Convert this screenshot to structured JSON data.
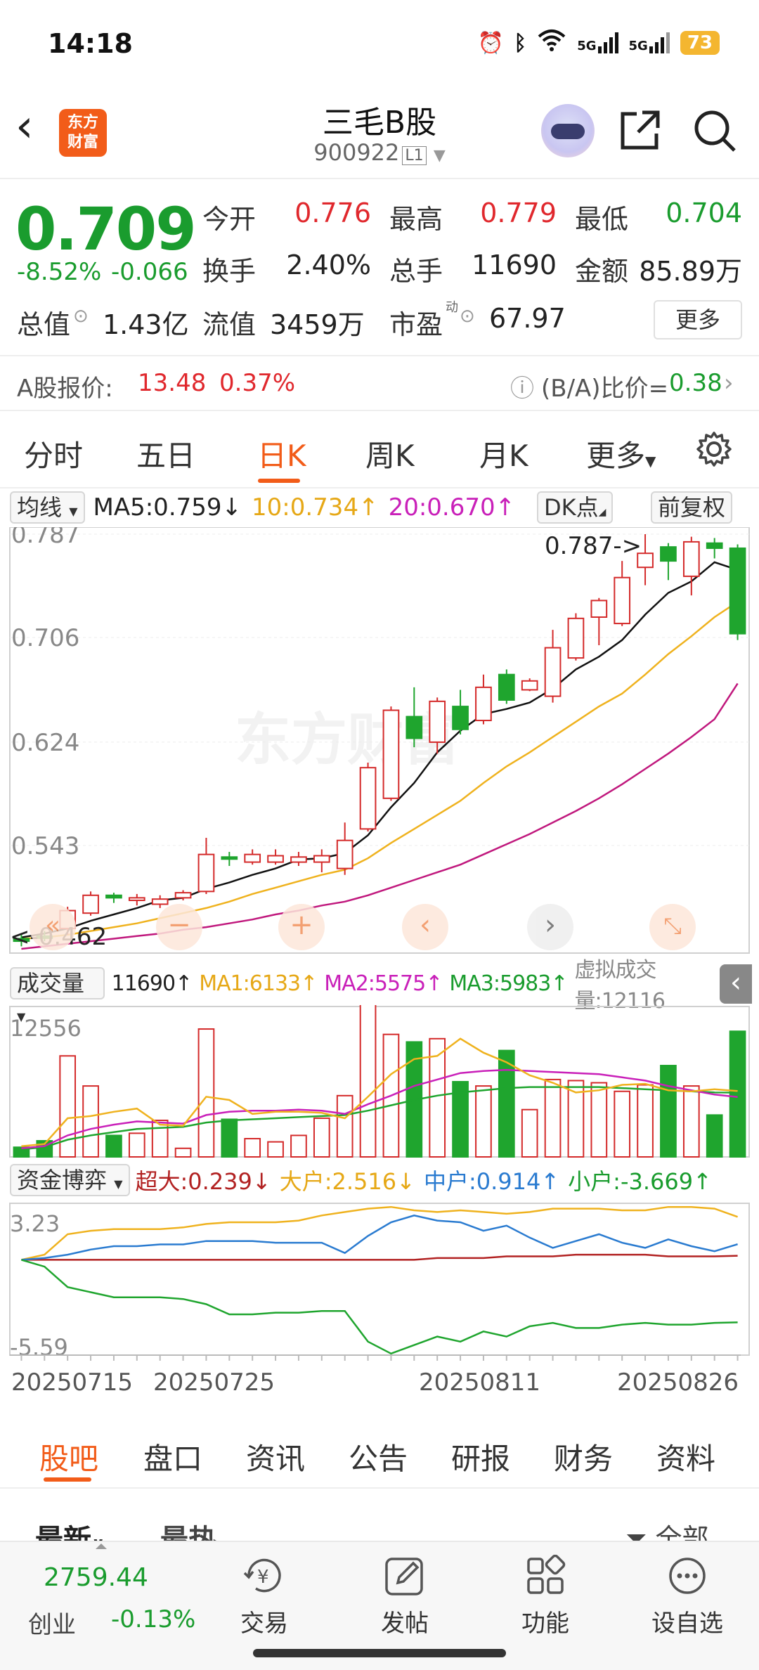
{
  "status": {
    "time": "14:18",
    "battery": "73",
    "signal1": "5G",
    "signal2": "5G"
  },
  "header": {
    "logo_line1": "东方",
    "logo_line2": "财富",
    "title": "三毛B股",
    "code": "900922",
    "code_badge": "L1"
  },
  "quote": {
    "price": "0.709",
    "change_pct": "-8.52%",
    "change_abs": "-0.066",
    "open_label": "今开",
    "open": "0.776",
    "high_label": "最高",
    "high": "0.779",
    "low_label": "最低",
    "low": "0.704",
    "turnover_label": "换手",
    "turnover": "2.40%",
    "volume_label": "总手",
    "volume": "11690",
    "amount_label": "金额",
    "amount": "85.89万",
    "mktcap_label": "总值",
    "mktcap": "1.43亿",
    "float_label": "流值",
    "float": "3459万",
    "pe_label": "市盈",
    "pe_sup": "动",
    "pe": "67.97",
    "more": "更多",
    "a_label": "A股报价:",
    "a_price": "13.48",
    "a_pct": "0.37%",
    "ba_label": "(B/A)比价=",
    "ba_value": "0.38"
  },
  "tabs": [
    "分时",
    "五日",
    "日K",
    "周K",
    "月K",
    "更多"
  ],
  "active_tab": "日K",
  "kline": {
    "indicator": "均线",
    "ma5": "MA5:0.759↓",
    "ma10": "10:0.734↑",
    "ma20": "20:0.670↑",
    "dk_label": "DK点",
    "adjust_label": "前复权",
    "y_labels": [
      "0.787",
      "0.706",
      "0.624",
      "0.543"
    ],
    "high_marker": "0.787->",
    "low_marker": "<-0.462",
    "watermark": "东方财富"
  },
  "volume": {
    "indicator": "成交量",
    "value": "11690↑",
    "ma1": "MA1:6133↑",
    "ma2": "MA2:5575↑",
    "ma3": "MA3:5983↑",
    "virtual": "虚拟成交量:12116",
    "max_label": "12556"
  },
  "fund": {
    "indicator": "资金博弈",
    "super": "超大:0.239↓",
    "large": "大户:2.516↓",
    "mid": "中户:0.914↑",
    "small": "小户:-3.669↑",
    "top_label": "3.23",
    "bottom_label": "-5.59"
  },
  "dates": [
    "20250715",
    "20250725",
    "20250811",
    "20250826"
  ],
  "bottom_tabs": [
    "股吧",
    "盘口",
    "资讯",
    "公告",
    "研报",
    "财务",
    "资料"
  ],
  "sub_tabs": {
    "latest": "最新",
    "hot": "最热",
    "all": "全部"
  },
  "dock": {
    "index_value": "2759.44",
    "index_name": "创业",
    "index_pct": "-0.13%",
    "items": [
      "交易",
      "发帖",
      "功能",
      "设自选"
    ]
  },
  "chart_data": {
    "type": "candlestick",
    "candles": [
      {
        "o": 0.47,
        "c": 0.468,
        "h": 0.474,
        "l": 0.464
      },
      {
        "o": 0.472,
        "c": 0.471,
        "h": 0.476,
        "l": 0.468
      },
      {
        "o": 0.478,
        "c": 0.492,
        "h": 0.495,
        "l": 0.473
      },
      {
        "o": 0.49,
        "c": 0.504,
        "h": 0.507,
        "l": 0.488
      },
      {
        "o": 0.504,
        "c": 0.502,
        "h": 0.506,
        "l": 0.498
      },
      {
        "o": 0.5,
        "c": 0.502,
        "h": 0.505,
        "l": 0.496
      },
      {
        "o": 0.497,
        "c": 0.501,
        "h": 0.504,
        "l": 0.494
      },
      {
        "o": 0.502,
        "c": 0.506,
        "h": 0.508,
        "l": 0.5
      },
      {
        "o": 0.507,
        "c": 0.536,
        "h": 0.549,
        "l": 0.505
      },
      {
        "o": 0.534,
        "c": 0.533,
        "h": 0.538,
        "l": 0.527
      },
      {
        "o": 0.53,
        "c": 0.536,
        "h": 0.54,
        "l": 0.528
      },
      {
        "o": 0.53,
        "c": 0.535,
        "h": 0.54,
        "l": 0.528
      },
      {
        "o": 0.53,
        "c": 0.534,
        "h": 0.538,
        "l": 0.527
      },
      {
        "o": 0.53,
        "c": 0.535,
        "h": 0.54,
        "l": 0.522
      },
      {
        "o": 0.525,
        "c": 0.547,
        "h": 0.561,
        "l": 0.52
      },
      {
        "o": 0.556,
        "c": 0.604,
        "h": 0.608,
        "l": 0.554
      },
      {
        "o": 0.58,
        "c": 0.649,
        "h": 0.652,
        "l": 0.578
      },
      {
        "o": 0.644,
        "c": 0.627,
        "h": 0.667,
        "l": 0.62
      },
      {
        "o": 0.624,
        "c": 0.656,
        "h": 0.659,
        "l": 0.615
      },
      {
        "o": 0.652,
        "c": 0.634,
        "h": 0.665,
        "l": 0.63
      },
      {
        "o": 0.641,
        "c": 0.667,
        "h": 0.677,
        "l": 0.638
      },
      {
        "o": 0.677,
        "c": 0.657,
        "h": 0.681,
        "l": 0.654
      },
      {
        "o": 0.665,
        "c": 0.672,
        "h": 0.674,
        "l": 0.664
      },
      {
        "o": 0.66,
        "c": 0.698,
        "h": 0.712,
        "l": 0.655
      },
      {
        "o": 0.69,
        "c": 0.721,
        "h": 0.725,
        "l": 0.688
      },
      {
        "o": 0.722,
        "c": 0.735,
        "h": 0.737,
        "l": 0.7
      },
      {
        "o": 0.717,
        "c": 0.753,
        "h": 0.766,
        "l": 0.715
      },
      {
        "o": 0.761,
        "c": 0.772,
        "h": 0.787,
        "l": 0.747
      },
      {
        "o": 0.777,
        "c": 0.766,
        "h": 0.78,
        "l": 0.751
      },
      {
        "o": 0.754,
        "c": 0.781,
        "h": 0.785,
        "l": 0.739
      },
      {
        "o": 0.78,
        "c": 0.776,
        "h": 0.784,
        "l": 0.768
      },
      {
        "o": 0.776,
        "c": 0.709,
        "h": 0.779,
        "l": 0.704
      }
    ],
    "ma5": [
      0.471,
      0.474,
      0.478,
      0.484,
      0.489,
      0.494,
      0.5,
      0.502,
      0.509,
      0.514,
      0.52,
      0.525,
      0.532,
      0.533,
      0.537,
      0.551,
      0.573,
      0.592,
      0.616,
      0.633,
      0.646,
      0.65,
      0.655,
      0.666,
      0.681,
      0.691,
      0.704,
      0.724,
      0.741,
      0.75,
      0.765,
      0.759
    ],
    "ma10": [
      0.47,
      0.471,
      0.473,
      0.476,
      0.479,
      0.482,
      0.486,
      0.49,
      0.494,
      0.499,
      0.505,
      0.51,
      0.515,
      0.52,
      0.524,
      0.533,
      0.545,
      0.556,
      0.567,
      0.578,
      0.592,
      0.605,
      0.616,
      0.628,
      0.64,
      0.652,
      0.662,
      0.677,
      0.693,
      0.707,
      0.722,
      0.734
    ],
    "ma20": [
      0.462,
      0.464,
      0.466,
      0.468,
      0.47,
      0.472,
      0.474,
      0.477,
      0.479,
      0.482,
      0.485,
      0.489,
      0.492,
      0.496,
      0.499,
      0.504,
      0.51,
      0.516,
      0.522,
      0.528,
      0.536,
      0.544,
      0.552,
      0.561,
      0.57,
      0.58,
      0.591,
      0.603,
      0.615,
      0.628,
      0.642,
      0.67
    ],
    "volume": [
      900,
      1500,
      9400,
      6600,
      2000,
      2200,
      3400,
      800,
      11900,
      3500,
      1700,
      1400,
      2000,
      3600,
      5700,
      14200,
      11400,
      10700,
      11000,
      7000,
      6600,
      9900,
      4400,
      7200,
      7100,
      6900,
      6100,
      6700,
      8500,
      6600,
      3900,
      11690
    ],
    "vol_ma1": [
      1000,
      1200,
      3600,
      3800,
      4200,
      4500,
      3000,
      2900,
      5600,
      5300,
      4000,
      4200,
      4200,
      4100,
      3600,
      5600,
      7700,
      9100,
      9400,
      11000,
      9700,
      8800,
      7600,
      6900,
      6000,
      6200,
      6700,
      6800,
      6200,
      6100,
      6300,
      6133
    ],
    "vol_ma2": [
      800,
      1000,
      2000,
      2600,
      3000,
      3300,
      3200,
      3100,
      3900,
      4200,
      4300,
      4300,
      4400,
      4300,
      4000,
      4900,
      5700,
      6600,
      7200,
      7800,
      8000,
      8100,
      8000,
      7900,
      7800,
      7700,
      7400,
      7100,
      6600,
      6200,
      5800,
      5575
    ],
    "vol_ma3": [
      700,
      900,
      1600,
      2000,
      2300,
      2600,
      2700,
      2800,
      3200,
      3400,
      3500,
      3600,
      3700,
      3800,
      3900,
      4300,
      4800,
      5300,
      5700,
      6000,
      6200,
      6400,
      6500,
      6500,
      6500,
      6500,
      6400,
      6300,
      6200,
      6100,
      6000,
      5983
    ],
    "fund_super": [
      0,
      0,
      0,
      0,
      0,
      0,
      0,
      0,
      0,
      0,
      0,
      0,
      0,
      0,
      0,
      0,
      0,
      0,
      0.1,
      0.1,
      0.1,
      0.2,
      0.2,
      0.2,
      0.3,
      0.3,
      0.3,
      0.3,
      0.2,
      0.2,
      0.2,
      0.239
    ],
    "fund_large": [
      0,
      0.3,
      1.5,
      1.7,
      1.8,
      1.8,
      1.8,
      1.9,
      2.1,
      2.2,
      2.2,
      2.2,
      2.3,
      2.6,
      2.8,
      3.0,
      3.1,
      2.9,
      2.8,
      2.9,
      2.8,
      2.7,
      2.8,
      3.0,
      3.0,
      3.0,
      2.9,
      2.9,
      3.1,
      3.1,
      3.0,
      2.516
    ],
    "fund_mid": [
      0,
      0.1,
      0.3,
      0.6,
      0.8,
      0.8,
      0.9,
      0.9,
      1.1,
      1.1,
      1.1,
      1.0,
      1.0,
      1.0,
      0.4,
      1.4,
      2.2,
      2.6,
      2.3,
      2.2,
      1.7,
      2.0,
      1.3,
      0.7,
      1.1,
      1.5,
      1.0,
      0.7,
      1.2,
      0.8,
      0.5,
      0.914
    ],
    "fund_small": [
      0,
      -0.4,
      -1.6,
      -1.9,
      -2.2,
      -2.2,
      -2.2,
      -2.3,
      -2.6,
      -3.2,
      -3.2,
      -3.1,
      -3.1,
      -3.0,
      -3.0,
      -4.8,
      -5.5,
      -5.0,
      -4.5,
      -4.8,
      -4.2,
      -4.5,
      -3.9,
      -3.7,
      -4.0,
      -4.0,
      -3.8,
      -3.7,
      -3.8,
      -3.8,
      -3.7,
      -3.669
    ],
    "y_range": [
      0.462,
      0.787
    ],
    "vol_max": 12556,
    "fund_range": [
      -5.59,
      3.23
    ]
  }
}
